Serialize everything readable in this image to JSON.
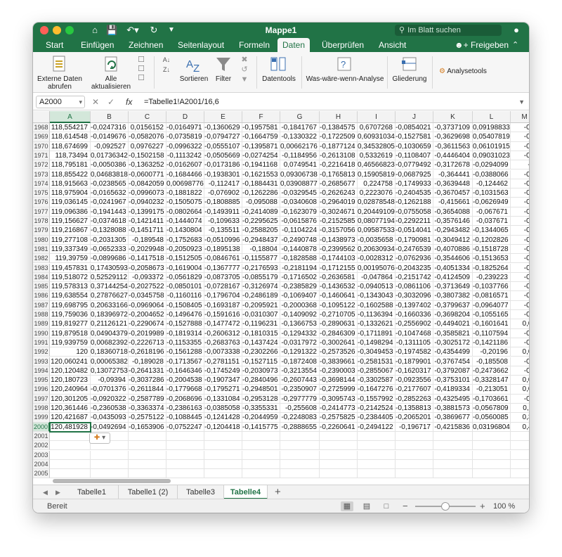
{
  "window": {
    "title": "Mappe1",
    "search_placeholder": "Im Blatt suchen",
    "accent": "#217346"
  },
  "ribbon_tabs": [
    "Start",
    "Einfügen",
    "Zeichnen",
    "Seitenlayout",
    "Formeln",
    "Daten",
    "Überprüfen",
    "Ansicht"
  ],
  "active_tab": "Daten",
  "share_label": "Freigeben",
  "ribbon_groups": {
    "external_data": "Externe Daten\nabrufen",
    "refresh_all": "Alle\naktualisieren",
    "sort": "Sortieren",
    "filter": "Filter",
    "data_tools": "Datentools",
    "what_if": "Was-wäre-wenn-Analyse",
    "outline": "Gliederung",
    "analysis_tools": "Analysetools"
  },
  "name_box": "A2000",
  "formula": "=Tabelle1!A2001/16,6",
  "fx_label": "fx",
  "column_headers": [
    "A",
    "B",
    "C",
    "D",
    "E",
    "F",
    "G",
    "H",
    "I",
    "J",
    "K",
    "L",
    "M"
  ],
  "rows": [
    {
      "n": "1968",
      "c": [
        "118,554217",
        "-0,0247316",
        "0,0156152",
        "-0,0164971",
        "-0,1360629",
        "-0,1957581",
        "-0,1841767",
        "-0,1384575",
        "0,6707268",
        "-0,0854021",
        "-0,3737109",
        "0,09198833",
        "-0,0"
      ]
    },
    {
      "n": "1969",
      "c": [
        "118,614548",
        "-0,0149676",
        "-0,0582076",
        "-0,0735819",
        "-0,0794727",
        "-0,1664759",
        "-0,1330322",
        "-0,1722509",
        "0,60931034",
        "-0,1527581",
        "-0,3629698",
        "0,05407819",
        "-0,0"
      ]
    },
    {
      "n": "1970",
      "c": [
        "118,674699",
        "-0,092527",
        "0,0976227",
        "-0,0996322",
        "-0,0555107",
        "-0,1395871",
        "0,00662176",
        "-0,1877124",
        "0,34532805",
        "-0,1030659",
        "-0,3611563",
        "0,06101915",
        "-0,1"
      ]
    },
    {
      "n": "1971",
      "c": [
        "118,73494",
        "0,01736342",
        "-0,1502158",
        "-0,1113242",
        "-0,0505669",
        "-0,0274254",
        "-0,1184956",
        "-0,2613108",
        "0,5332619",
        "-0,1108407",
        "-0,4446404",
        "0,09031023",
        "-0,0"
      ]
    },
    {
      "n": "1972",
      "c": [
        "118,795181",
        "-0,0050386",
        "-0,1363252",
        "-0,0162607",
        "-0,0173186",
        "-0,1941168",
        "0,0749541",
        "-0,2216418",
        "0,46566823",
        "-0,0779492",
        "-0,3172678",
        "-0,0294099",
        "-0,"
      ]
    },
    {
      "n": "1973",
      "c": [
        "118,855422",
        "0,04683818",
        "-0,0600771",
        "-0,1684466",
        "-0,1938301",
        "-0,1621553",
        "0,09306738",
        "-0,1765813",
        "0,15905819",
        "-0,0687925",
        "-0,364441",
        "-0,0388066",
        "-0,1"
      ]
    },
    {
      "n": "1974",
      "c": [
        "118,915663",
        "-0,0238565",
        "-0,0842059",
        "0,00698776",
        "-0,112417",
        "-0,1884431",
        "0,03908877",
        "-0,2685677",
        "0,224758",
        "-0,1749933",
        "-0,3639448",
        "-0,124462",
        "-0,0"
      ]
    },
    {
      "n": "1975",
      "c": [
        "118,975904",
        "-0,0165632",
        "-0,0996073",
        "-0,1881822",
        "-0,076902",
        "-0,1262286",
        "-0,0329545",
        "-0,2626243",
        "0,2223076",
        "-0,2404535",
        "-0,3670457",
        "-0,1031563",
        "-0,1"
      ]
    },
    {
      "n": "1976",
      "c": [
        "119,036145",
        "-0,0241967",
        "-0,0940232",
        "-0,1505075",
        "-0,1808885",
        "-0,095088",
        "-0,0340608",
        "-0,2964019",
        "0,02878548",
        "-0,1262188",
        "-0,415661",
        "-0,0626949",
        "-0,1"
      ]
    },
    {
      "n": "1977",
      "c": [
        "119,096386",
        "-0,1941443",
        "-0,1399175",
        "-0,0802664",
        "-0,1493911",
        "-0,2414089",
        "-0,1623079",
        "-0,3024671",
        "0,20449109",
        "-0,0755058",
        "-0,3654088",
        "-0,067671",
        "-0,0"
      ]
    },
    {
      "n": "1978",
      "c": [
        "119,156627",
        "-0,0374618",
        "-0,1421411",
        "-0,1444074",
        "-0,109633",
        "-0,2295625",
        "-0,0615876",
        "-0,2152585",
        "0,08077194",
        "-0,2292211",
        "-0,3576146",
        "-0,037671",
        "-0,1"
      ]
    },
    {
      "n": "1979",
      "c": [
        "119,216867",
        "-0,1328088",
        "-0,1451711",
        "-0,1430804",
        "-0,135511",
        "-0,2588205",
        "-0,1104224",
        "-0,3157056",
        "0,09587533",
        "-0,0514041",
        "-0,2943482",
        "-0,1344065",
        "-0,0"
      ]
    },
    {
      "n": "1980",
      "c": [
        "119,277108",
        "-0,2031305",
        "-0,189548",
        "-0,1752683",
        "-0,0510996",
        "-0,2948437",
        "-0,2490748",
        "-0,1438973",
        "-0,0035658",
        "-0,1790981",
        "-0,3049412",
        "-0,1202826",
        "-0,1"
      ]
    },
    {
      "n": "1981",
      "c": [
        "119,337349",
        "-0,0652333",
        "-0,2029948",
        "-0,2050923",
        "-0,1895138",
        "-0,18804",
        "-0,1440878",
        "-0,2399562",
        "0,20630934",
        "-0,2476539",
        "-0,4070886",
        "-0,1518728",
        "-0,1"
      ]
    },
    {
      "n": "1982",
      "c": [
        "119,39759",
        "-0,0899686",
        "-0,1417518",
        "-0,1512505",
        "-0,0846761",
        "-0,1155877",
        "-0,1828588",
        "-0,1744103",
        "-0,0028312",
        "-0,0762936",
        "-0,3544606",
        "-0,1513653",
        "-0,1"
      ]
    },
    {
      "n": "1983",
      "c": [
        "119,457831",
        "0,17430593",
        "-0,2058673",
        "-0,1619004",
        "-0,1367777",
        "-0,2176593",
        "-0,2181194",
        "-0,1712155",
        "0,00195076",
        "-0,2043235",
        "-0,4051334",
        "-0,1825264",
        "-0,1"
      ]
    },
    {
      "n": "1984",
      "c": [
        "119,518072",
        "0,52529112",
        "-0,093372",
        "-0,0561829",
        "-0,0873705",
        "-0,0855179",
        "-0,1716502",
        "-0,2636581",
        "-0,047864",
        "-0,2151742",
        "-0,4124509",
        "-0,239223",
        "-0,1"
      ]
    },
    {
      "n": "1985",
      "c": [
        "119,578313",
        "0,37144254",
        "-0,2027522",
        "-0,0850101",
        "-0,0728167",
        "-0,3126974",
        "-0,2385829",
        "-0,1436532",
        "-0,0940513",
        "-0,0861106",
        "-0,3713649",
        "-0,1037766",
        "-0,1"
      ]
    },
    {
      "n": "1986",
      "c": [
        "119,638554",
        "0,27876627",
        "-0,0345758",
        "-0,1160116",
        "-0,1796704",
        "-0,2486189",
        "-0,1069407",
        "-0,1460641",
        "-0,1343043",
        "-0,3032096",
        "-0,3807382",
        "-0,0816571",
        "-0,0"
      ]
    },
    {
      "n": "1987",
      "c": [
        "119,698795",
        "0,20633166",
        "-0,0969064",
        "-0,1508405",
        "-0,1693187",
        "-0,2095921",
        "-0,2000368",
        "-0,1095122",
        "-0,1602588",
        "-0,1397402",
        "-0,3799637",
        "-0,0964077",
        "-0,1"
      ]
    },
    {
      "n": "1988",
      "c": [
        "119,759036",
        "0,18396972",
        "-0,2004652",
        "-0,1496476",
        "-0,1591616",
        "-0,0310307",
        "-0,1409092",
        "-0,2710705",
        "-0,1136394",
        "-0,1660336",
        "-0,3698204",
        "-0,1055165",
        "-0,0"
      ]
    },
    {
      "n": "1989",
      "c": [
        "119,819277",
        "0,21126121",
        "-0,2290674",
        "-0,1527888",
        "-0,1477472",
        "-0,1196231",
        "-0,1366753",
        "-0,2890631",
        "-0,1332621",
        "-0,2556902",
        "-0,4494021",
        "-0,1601641",
        "0,00"
      ]
    },
    {
      "n": "1990",
      "c": [
        "119,879518",
        "0,04904379",
        "-0,2019989",
        "-0,1819314",
        "-0,2606312",
        "-0,1810315",
        "-0,1294332",
        "-0,2846309",
        "-0,1711891",
        "-0,1047468",
        "-0,3585821",
        "-0,1107594",
        "-0,2"
      ]
    },
    {
      "n": "1991",
      "c": [
        "119,939759",
        "0,00682392",
        "-0,2226713",
        "-0,1153355",
        "-0,2683763",
        "-0,1437424",
        "-0,0317972",
        "-0,3002641",
        "-0,1498294",
        "-0,1311105",
        "-0,3025172",
        "-0,1421186",
        "-0,0"
      ]
    },
    {
      "n": "1992",
      "c": [
        "120",
        "0,18360718",
        "-0,2618196",
        "-0,1561288",
        "-0,0073338",
        "-0,2302266",
        "-0,1291322",
        "-0,2573526",
        "-0,3049453",
        "-0,1974582",
        "-0,4354499",
        "-0,20196",
        "0,02"
      ]
    },
    {
      "n": "1993",
      "c": [
        "120,060241",
        "0,00065382",
        "-0,189028",
        "-0,1713567",
        "-0,2781151",
        "-0,1527115",
        "-0,1872408",
        "-0,3839661",
        "-0,2581531",
        "-0,1879901",
        "-0,3767454",
        "-0,185508",
        "-0,1"
      ]
    },
    {
      "n": "1994",
      "c": [
        "120,120482",
        "0,13072753",
        "-0,2641331",
        "-0,1646346",
        "-0,1745249",
        "-0,2030973",
        "-0,3213554",
        "-0,2390003",
        "-0,2855067",
        "-0,1620317",
        "-0,3792087",
        "-0,2473662",
        "-0,1"
      ]
    },
    {
      "n": "1995",
      "c": [
        "120,180723",
        "-0,09394",
        "-0,3037286",
        "-0,2004538",
        "-0,1907347",
        "-0,2840496",
        "-0,2607443",
        "-0,3698144",
        "-0,3302587",
        "-0,0923556",
        "-0,3753101",
        "-0,3328147",
        "0,01"
      ]
    },
    {
      "n": "1996",
      "c": [
        "120,240964",
        "-0,0701376",
        "-0,2611844",
        "-0,1779668",
        "-0,1795271",
        "-0,2948501",
        "-0,2350907",
        "-0,2725999",
        "-0,1647276",
        "-0,2177607",
        "-0,4189334",
        "-0,213051",
        "0,04"
      ]
    },
    {
      "n": "1997",
      "c": [
        "120,301205",
        "-0,0920322",
        "-0,2587789",
        "-0,2068696",
        "-0,1331084",
        "-0,2953128",
        "-0,2977779",
        "-0,3095743",
        "-0,1557992",
        "-0,2852263",
        "-0,4325495",
        "-0,1703661",
        "-0,0"
      ]
    },
    {
      "n": "1998",
      "c": [
        "120,361446",
        "-0,2360538",
        "-0,3363374",
        "-0,2386163",
        "-0,0385058",
        "-0,3355331",
        "-0,255608",
        "-0,2414773",
        "-0,2142524",
        "-0,1358813",
        "-0,3881573",
        "-0,0567809",
        "0,11"
      ]
    },
    {
      "n": "1999",
      "c": [
        "120,421687",
        "-0,0435093",
        "-0,2575122",
        "-0,1088445",
        "-0,1241428",
        "-0,2044959",
        "-0,2248083",
        "-0,2575825",
        "-0,2384405",
        "-0,2065201",
        "-0,3869677",
        "-0,0560085",
        "0,38"
      ]
    },
    {
      "n": "2000",
      "c": [
        "120,481928",
        "-0,0492694",
        "-0,1653906",
        "-0,0752247",
        "-0,1204418",
        "-0,1415775",
        "-0,2888655",
        "-0,2260641",
        "-0,2494122",
        "-0,196717",
        "-0,4215836",
        "0,03196804",
        "0,45"
      ]
    },
    {
      "n": "2001",
      "c": [
        "",
        "",
        "",
        "",
        "",
        "",
        "",
        "",
        "",
        "",
        "",
        "",
        ""
      ]
    },
    {
      "n": "2002",
      "c": [
        "",
        "",
        "",
        "",
        "",
        "",
        "",
        "",
        "",
        "",
        "",
        "",
        ""
      ]
    },
    {
      "n": "2003",
      "c": [
        "",
        "",
        "",
        "",
        "",
        "",
        "",
        "",
        "",
        "",
        "",
        "",
        ""
      ]
    },
    {
      "n": "2004",
      "c": [
        "",
        "",
        "",
        "",
        "",
        "",
        "",
        "",
        "",
        "",
        "",
        "",
        ""
      ]
    },
    {
      "n": "2005",
      "c": [
        "",
        "",
        "",
        "",
        "",
        "",
        "",
        "",
        "",
        "",
        "",
        "",
        ""
      ]
    }
  ],
  "sheet_tabs": [
    "Tabelle1",
    "Tabelle1 (2)",
    "Tabelle3",
    "Tabelle4"
  ],
  "active_sheet": "Tabelle4",
  "status": {
    "text": "Bereit",
    "zoom": "100 %",
    "zoom_fraction": 0.5
  }
}
